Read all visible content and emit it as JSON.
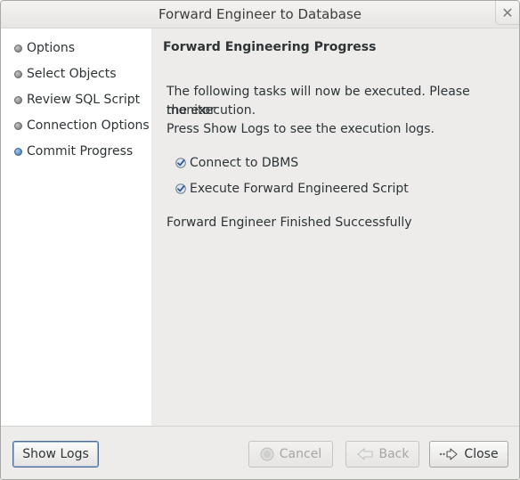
{
  "window": {
    "title": "Forward Engineer to Database"
  },
  "sidebar": {
    "steps": [
      {
        "label": "Options",
        "state": "done"
      },
      {
        "label": "Select Objects",
        "state": "done"
      },
      {
        "label": "Review SQL Script",
        "state": "done"
      },
      {
        "label": "Connection Options",
        "state": "done"
      },
      {
        "label": "Commit Progress",
        "state": "active"
      }
    ]
  },
  "main": {
    "heading": "Forward Engineering Progress",
    "description_line1": "The following tasks will now be executed. Please monitor",
    "description_line2": "the execution.",
    "description_line3": "Press Show Logs to see the execution logs.",
    "tasks": [
      {
        "label": "Connect to DBMS",
        "checked": true
      },
      {
        "label": "Execute Forward Engineered Script",
        "checked": true
      }
    ],
    "result": "Forward Engineer Finished Successfully"
  },
  "buttons": {
    "show_logs": "Show Logs",
    "cancel": "Cancel",
    "back": "Back",
    "close": "Close"
  },
  "colors": {
    "window_bg": "#edeceb",
    "sidebar_bg": "#ffffff",
    "active_step_dot": "#3b6ea5",
    "check_color": "#3465a4"
  }
}
